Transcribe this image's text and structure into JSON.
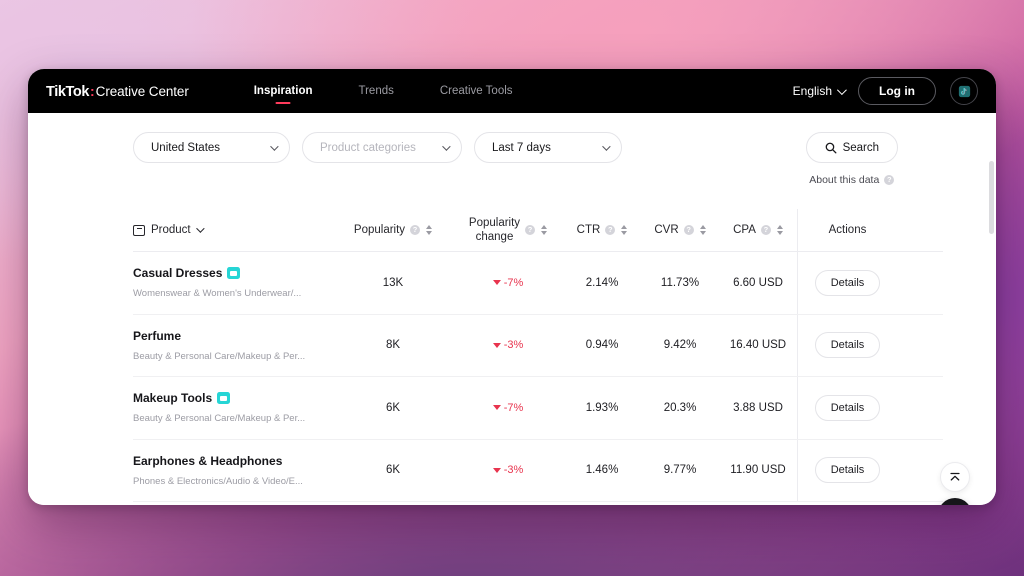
{
  "navbar": {
    "brand": {
      "tiktok": "TikTok",
      "separator": ":",
      "suffix": "Creative Center"
    },
    "links": [
      {
        "label": "Inspiration",
        "active": true
      },
      {
        "label": "Trends",
        "active": false
      },
      {
        "label": "Creative Tools",
        "active": false
      }
    ],
    "language": "English",
    "login_label": "Log in",
    "avatar_icon": "tiktok-avatar-icon",
    "background": "#000000",
    "accent": "#ff3b5c"
  },
  "filters": [
    {
      "name": "region",
      "value": "United States",
      "is_placeholder": false
    },
    {
      "name": "product-categories",
      "value": "Product categories",
      "is_placeholder": true
    },
    {
      "name": "date-range",
      "value": "Last 7 days",
      "is_placeholder": false
    }
  ],
  "search": {
    "button_label": "Search",
    "icon": "search-icon",
    "about_label": "About this data",
    "about_info_icon": "info-icon"
  },
  "table": {
    "headers": {
      "product": "Product",
      "popularity": "Popularity",
      "popularity_change_line1": "Popularity",
      "popularity_change_line2": "change",
      "ctr": "CTR",
      "cvr": "CVR",
      "cpa": "CPA",
      "actions": "Actions"
    },
    "details_label": "Details",
    "rows": [
      {
        "product": "Casual Dresses",
        "has_video_badge": true,
        "category": "Womenswear & Women's Underwear/...",
        "popularity": "13K",
        "popularity_change": "-7%",
        "change_direction": "down",
        "ctr": "2.14%",
        "cvr": "11.73%",
        "cpa": "6.60 USD"
      },
      {
        "product": "Perfume",
        "has_video_badge": false,
        "category": "Beauty & Personal Care/Makeup & Per...",
        "popularity": "8K",
        "popularity_change": "-3%",
        "change_direction": "down",
        "ctr": "0.94%",
        "cvr": "9.42%",
        "cpa": "16.40 USD"
      },
      {
        "product": "Makeup Tools",
        "has_video_badge": true,
        "category": "Beauty & Personal Care/Makeup & Per...",
        "popularity": "6K",
        "popularity_change": "-7%",
        "change_direction": "down",
        "ctr": "1.93%",
        "cvr": "20.3%",
        "cpa": "3.88 USD"
      },
      {
        "product": "Earphones & Headphones",
        "has_video_badge": false,
        "category": "Phones & Electronics/Audio & Video/E...",
        "popularity": "6K",
        "popularity_change": "-3%",
        "change_direction": "down",
        "ctr": "1.46%",
        "cvr": "9.77%",
        "cpa": "11.90 USD"
      }
    ],
    "negative_color": "#e8344e",
    "video_badge_color": "#26d5d5"
  },
  "floating_buttons": [
    {
      "name": "scroll-to-top-button",
      "icon": "arrow-up-to-line-icon"
    },
    {
      "name": "chat-support-button",
      "icon": "chat-bubble-icon"
    }
  ]
}
